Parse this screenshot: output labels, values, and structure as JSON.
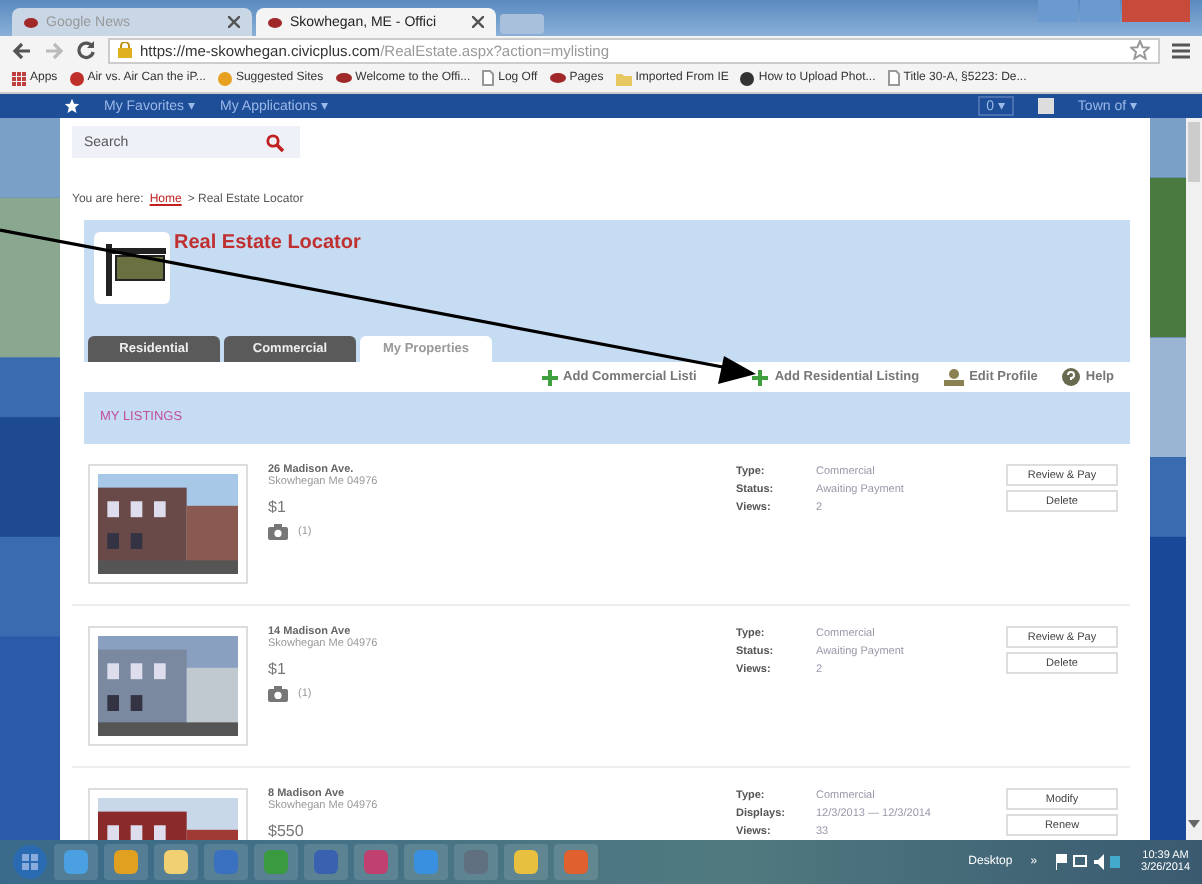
{
  "browser": {
    "tabs": [
      {
        "label": "Google News",
        "selected": false
      },
      {
        "label": "Skowhegan, ME - Offici",
        "selected": true
      }
    ],
    "url_host": "https://me-skowhegan.civicplus.com",
    "url_path": "/RealEstate.aspx?action=mylisting",
    "bookmarks": [
      "Apps",
      "Air vs. Air Can the iP...",
      "Suggested Sites",
      "Welcome to the Offi...",
      "Log Off",
      "Pages",
      "Imported From IE",
      "How to Upload Phot...",
      "Title 30-A, §5223: De..."
    ]
  },
  "site_nav": {
    "items": [
      "My Favorites ▾",
      "My Applications ▾"
    ],
    "count": "0 ▾",
    "user": "Town of ▾"
  },
  "search": {
    "placeholder": "Search"
  },
  "breadcrumb": {
    "prefix": "You are here:",
    "link": "Home",
    "rest": "> Real Estate Locator"
  },
  "module": {
    "title": "Real Estate Locator",
    "tabs": [
      {
        "label": "Residential",
        "selected": false
      },
      {
        "label": "Commercial",
        "selected": false
      },
      {
        "label": "My Properties",
        "selected": true
      }
    ],
    "actions": [
      "Add Commercial Listi",
      "Add Residential Listing",
      "Edit Profile",
      "Help"
    ],
    "section_title": "MY LISTINGS"
  },
  "listings": [
    {
      "address": "26 Madison Ave.",
      "city": "Skowhegan Me  04976",
      "price": "$1",
      "photos": "(1)",
      "fields": [
        {
          "label": "Type:",
          "value": "Commercial"
        },
        {
          "label": "Status:",
          "value": "Awaiting Payment"
        },
        {
          "label": "Views:",
          "value": "2"
        }
      ],
      "buttons": [
        "Review & Pay",
        "Delete"
      ]
    },
    {
      "address": "14 Madison Ave",
      "city": "Skowhegan Me  04976",
      "price": "$1",
      "photos": "(1)",
      "fields": [
        {
          "label": "Type:",
          "value": "Commercial"
        },
        {
          "label": "Status:",
          "value": "Awaiting Payment"
        },
        {
          "label": "Views:",
          "value": "2"
        }
      ],
      "buttons": [
        "Review & Pay",
        "Delete"
      ]
    },
    {
      "address": "8 Madison Ave",
      "city": "Skowhegan Me  04976",
      "price": "$550",
      "fields": [
        {
          "label": "Type:",
          "value": "Commercial"
        },
        {
          "label": "Displays:",
          "value": "12/3/2013 — 12/3/2014"
        },
        {
          "label": "Views:",
          "value": "33"
        }
      ],
      "buttons": [
        "Modify",
        "Renew"
      ]
    }
  ],
  "taskbar": {
    "desktop": "Desktop",
    "overflow": "»",
    "time": "10:39 AM",
    "date": "3/26/2014"
  }
}
